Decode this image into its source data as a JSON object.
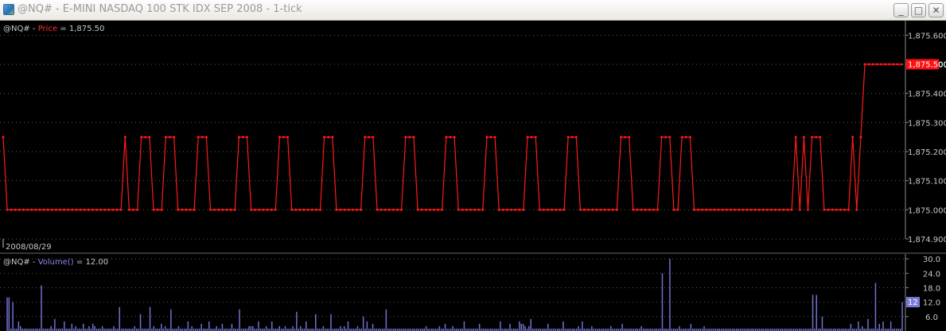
{
  "window": {
    "title": "@NQ# - E-MINI NASDAQ 100 STK IDX SEP 2008 - 1-tick",
    "minimize_glyph": "_",
    "maximize_glyph": "□",
    "close_glyph": "✕"
  },
  "colors": {
    "background": "#000000",
    "grid": "#5a5a5a",
    "price_line": "#ff1a1a",
    "volume_bar": "#6f6fd0",
    "axis_text": "#c8c8c8",
    "header_text": "#c8c8c8"
  },
  "chart_data": [
    {
      "type": "line",
      "symbol": "@NQ#",
      "separator": " - ",
      "indicator": "Price",
      "equals": " = ",
      "current_value_label": "1,875.50",
      "current_value_tag": "1,875.500",
      "date_label": "2008/08/29",
      "ylim": [
        1874.9,
        1875.65
      ],
      "yticks": [
        "1,875.600",
        "1,875.500",
        "1,875.400",
        "1,875.300",
        "1,875.200",
        "1,875.100",
        "1,875.000",
        "1,874.900"
      ],
      "yticks_values": [
        1875.6,
        1875.5,
        1875.4,
        1875.3,
        1875.2,
        1875.1,
        1875.0,
        1874.9
      ],
      "grid": true,
      "series": [
        {
          "values": [
            1875.25,
            1875,
            1875,
            1875,
            1875,
            1875,
            1875,
            1875,
            1875,
            1875,
            1875,
            1875,
            1875,
            1875,
            1875,
            1875,
            1875,
            1875,
            1875,
            1875,
            1875,
            1875,
            1875,
            1875,
            1875,
            1875,
            1875,
            1875,
            1875,
            1875,
            1875.25,
            1875,
            1875,
            1875,
            1875.25,
            1875.25,
            1875.25,
            1875,
            1875,
            1875,
            1875.25,
            1875.25,
            1875.25,
            1875,
            1875,
            1875,
            1875,
            1875,
            1875.25,
            1875.25,
            1875.25,
            1875,
            1875,
            1875,
            1875,
            1875,
            1875,
            1875,
            1875.25,
            1875.25,
            1875.25,
            1875,
            1875,
            1875,
            1875,
            1875,
            1875,
            1875,
            1875.25,
            1875.25,
            1875.25,
            1875,
            1875,
            1875,
            1875,
            1875,
            1875,
            1875,
            1875,
            1875.25,
            1875.25,
            1875.25,
            1875,
            1875,
            1875,
            1875,
            1875,
            1875,
            1875,
            1875.25,
            1875.25,
            1875.25,
            1875,
            1875,
            1875,
            1875,
            1875,
            1875,
            1875,
            1875.25,
            1875.25,
            1875.25,
            1875,
            1875,
            1875,
            1875,
            1875,
            1875,
            1875,
            1875.25,
            1875.25,
            1875.25,
            1875,
            1875,
            1875,
            1875,
            1875,
            1875,
            1875,
            1875.25,
            1875.25,
            1875.25,
            1875,
            1875,
            1875,
            1875,
            1875,
            1875,
            1875,
            1875.25,
            1875.25,
            1875.25,
            1875,
            1875,
            1875,
            1875,
            1875,
            1875,
            1875,
            1875.25,
            1875.25,
            1875.25,
            1875,
            1875,
            1875,
            1875,
            1875,
            1875,
            1875,
            1875,
            1875,
            1875,
            1875.25,
            1875.25,
            1875.25,
            1875,
            1875,
            1875,
            1875,
            1875,
            1875,
            1875,
            1875.25,
            1875.25,
            1875.25,
            1875,
            1875,
            1875.25,
            1875.25,
            1875.25,
            1875,
            1875,
            1875,
            1875,
            1875,
            1875,
            1875,
            1875,
            1875,
            1875,
            1875,
            1875,
            1875,
            1875,
            1875,
            1875,
            1875,
            1875,
            1875,
            1875,
            1875,
            1875,
            1875,
            1875,
            1875,
            1875.25,
            1875,
            1875.25,
            1875,
            1875.25,
            1875.25,
            1875.25,
            1875,
            1875,
            1875,
            1875,
            1875,
            1875,
            1875,
            1875.25,
            1875,
            1875.25,
            1875.5,
            1875.5,
            1875.5,
            1875.5,
            1875.5,
            1875.5,
            1875.5,
            1875.5,
            1875.5,
            1875.5
          ]
        }
      ]
    },
    {
      "type": "bar",
      "symbol": "@NQ#",
      "separator": " - ",
      "indicator": "Volume()",
      "equals": " = ",
      "current_value_label": "12.00",
      "current_value_tag": "12",
      "ylim": [
        0,
        32
      ],
      "yticks": [
        "30.0",
        "24.0",
        "18.0",
        "12.0",
        "6.0"
      ],
      "yticks_values": [
        30,
        24,
        18,
        12,
        6
      ],
      "grid": true,
      "series": [
        {
          "values": [
            14,
            14,
            1,
            12,
            1,
            1,
            4,
            2,
            1,
            1,
            1,
            1,
            1,
            1,
            1,
            1,
            1,
            1,
            19,
            1,
            1,
            1,
            1,
            2,
            1,
            5,
            1,
            1,
            1,
            1,
            4,
            1,
            1,
            1,
            3,
            1,
            2,
            1,
            1,
            1,
            3,
            1,
            1,
            2,
            1,
            3,
            2,
            1,
            1,
            1,
            2,
            1,
            1,
            1,
            1,
            1,
            2,
            1,
            1,
            10,
            1,
            1,
            1,
            1,
            1,
            1,
            1,
            2,
            1,
            1,
            7,
            1,
            1,
            1,
            1,
            10,
            1,
            2,
            1,
            1,
            1,
            3,
            1,
            2,
            1,
            1,
            9,
            1,
            1,
            1,
            2,
            1,
            1,
            1,
            1,
            4,
            1,
            2,
            1,
            1,
            1,
            1,
            3,
            1,
            1,
            1,
            4,
            1,
            1,
            1,
            2,
            1,
            1,
            3,
            1,
            1,
            1,
            1,
            3,
            1,
            1,
            1,
            9,
            1,
            1,
            1,
            1,
            2,
            2,
            2,
            1,
            1,
            4,
            1,
            1,
            1,
            2,
            1,
            1,
            4,
            1,
            1,
            1,
            2,
            1,
            1,
            2,
            1,
            1,
            1,
            2,
            1,
            8,
            1,
            2,
            1,
            1,
            4,
            1,
            1,
            1,
            1,
            7,
            1,
            1,
            1,
            2,
            1,
            1,
            1,
            7,
            1,
            1,
            1,
            1,
            2,
            1,
            2,
            1,
            4,
            1,
            1,
            1,
            1,
            2,
            1,
            1,
            6,
            1,
            4,
            1,
            1,
            3,
            1,
            1,
            1,
            1,
            1,
            1,
            9,
            1,
            1,
            1,
            1,
            1,
            1,
            1,
            1,
            1,
            1,
            1,
            1,
            1,
            1,
            1,
            1,
            1,
            1,
            1,
            1,
            2,
            1,
            1,
            1,
            1,
            1,
            1,
            2,
            1,
            1,
            3,
            1,
            1,
            1,
            2,
            1,
            1,
            1,
            1,
            1,
            4,
            1,
            1,
            1,
            1,
            1,
            1,
            1,
            3,
            1,
            1,
            1,
            1,
            1,
            1,
            1,
            1,
            1,
            1,
            4,
            1,
            1,
            1,
            1,
            3,
            1,
            1,
            1,
            1,
            4,
            3,
            3,
            2,
            1,
            2,
            5,
            1,
            1,
            1,
            1,
            1,
            1,
            1,
            1,
            3,
            1,
            1,
            1,
            1,
            1,
            1,
            1,
            4,
            1,
            1,
            1,
            1,
            1,
            1,
            1,
            2,
            1,
            4,
            1,
            1,
            1,
            1,
            2,
            1,
            1,
            1,
            1,
            1,
            1,
            1,
            1,
            1,
            2,
            1,
            1,
            1,
            1,
            1,
            3,
            1,
            1,
            1,
            1,
            1,
            1,
            1,
            1,
            1,
            2,
            1,
            1,
            1,
            1,
            1,
            1,
            1,
            1,
            1,
            1,
            24,
            1,
            1,
            1,
            30,
            1,
            1,
            1,
            1,
            2,
            1,
            1,
            1,
            1,
            1,
            3,
            1,
            1,
            1,
            1,
            1,
            1,
            2,
            1,
            1,
            1,
            1,
            1,
            1,
            1,
            1,
            1,
            1,
            1,
            1,
            1,
            1,
            1,
            1,
            1,
            1,
            1,
            1,
            1,
            1,
            1,
            1,
            1,
            1,
            1,
            1,
            1,
            1,
            1,
            1,
            1,
            1,
            1,
            1,
            1,
            1,
            1,
            1,
            1,
            1,
            1,
            1,
            1,
            1,
            1,
            1,
            1,
            1,
            1,
            1,
            1,
            1,
            1,
            1,
            15,
            1,
            15,
            1,
            1,
            6,
            1,
            1,
            1,
            1,
            1,
            1,
            1,
            1,
            1,
            1,
            1,
            1,
            1,
            1,
            3,
            1,
            1,
            1,
            4,
            1,
            2,
            1,
            1,
            5,
            1,
            1,
            1,
            20,
            1,
            3,
            1,
            4,
            1,
            1,
            1,
            4,
            1,
            1,
            1,
            1,
            1,
            12
          ]
        }
      ]
    }
  ]
}
